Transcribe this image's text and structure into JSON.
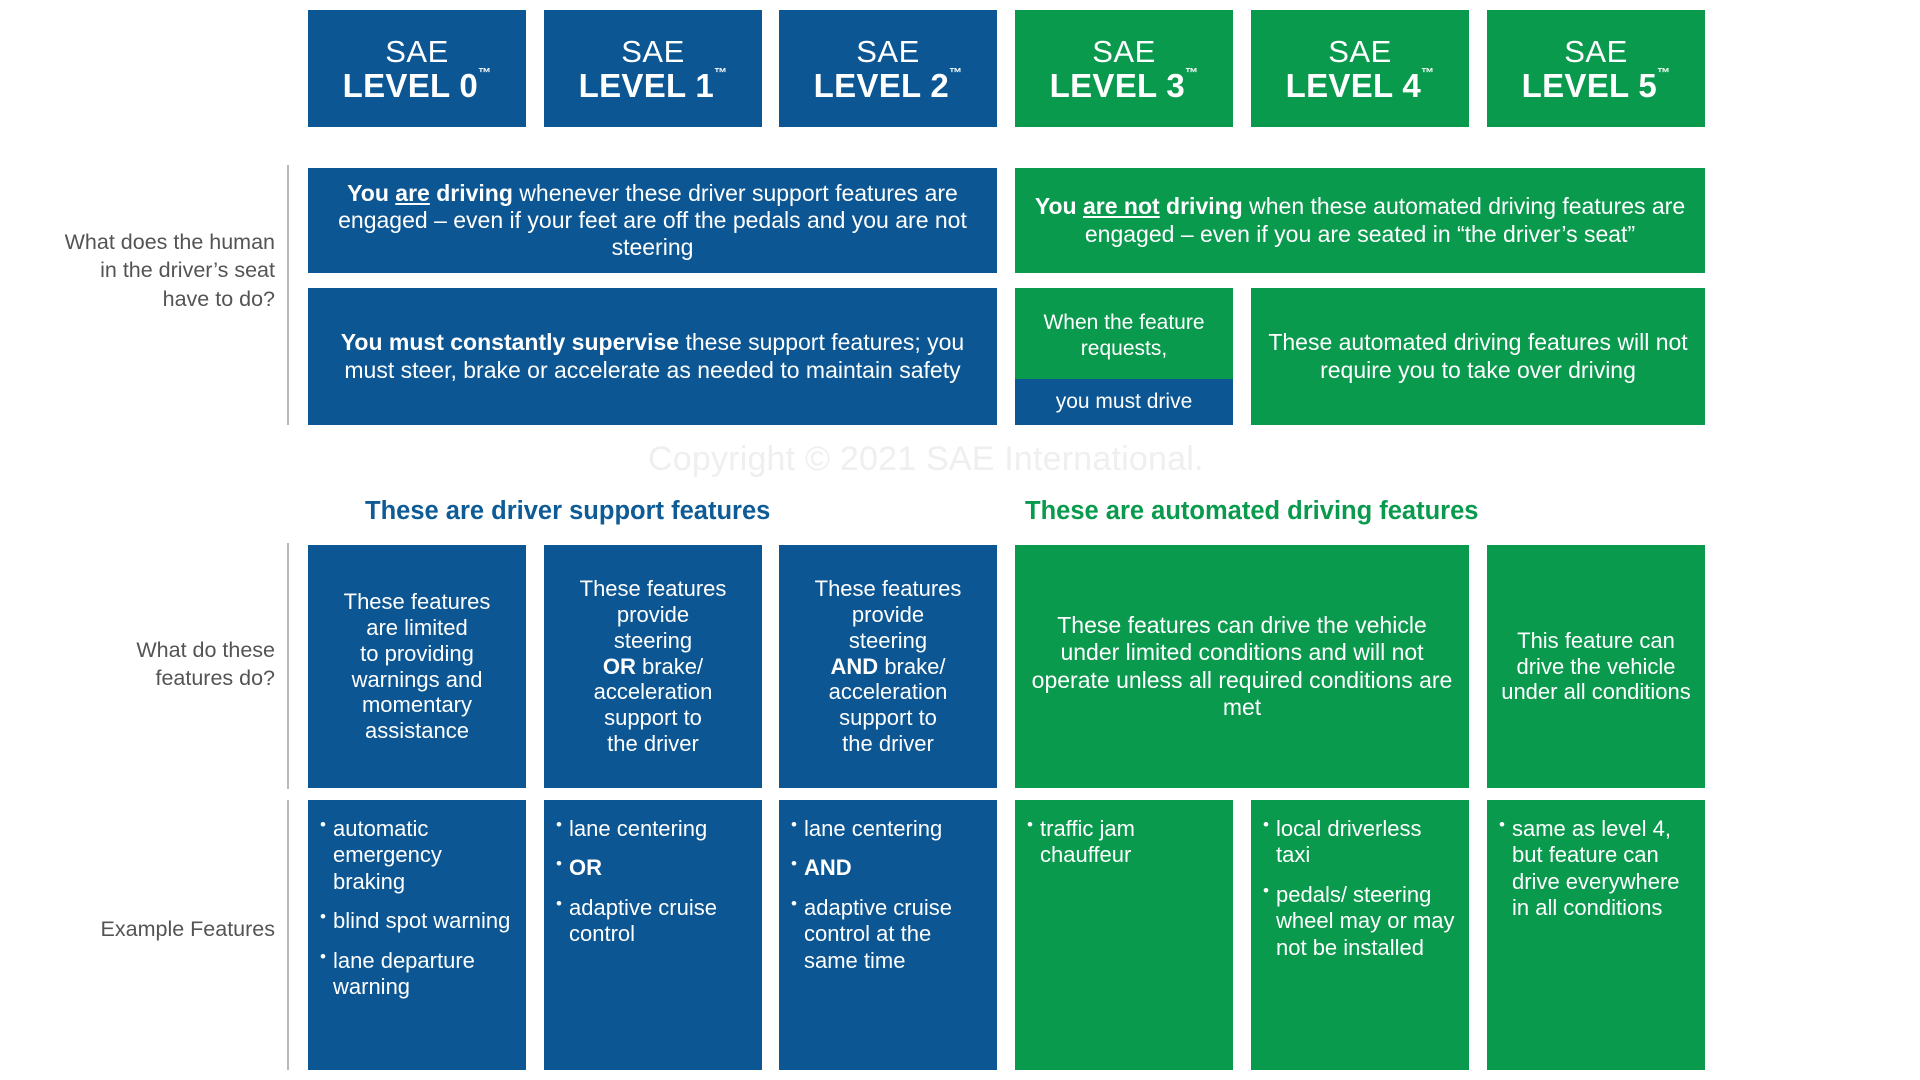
{
  "meta": {
    "watermark": "Copyright © 2021 SAE International.",
    "colors": {
      "blue": "#0b5693",
      "green": "#0a9a4e",
      "label_gray": "#545454",
      "watermark_gray": "#efefef"
    }
  },
  "levels": [
    {
      "id": "level-0",
      "sae": "SAE",
      "name": "LEVEL 0",
      "tm": "™",
      "color": "blue"
    },
    {
      "id": "level-1",
      "sae": "SAE",
      "name": "LEVEL 1",
      "tm": "™",
      "color": "blue"
    },
    {
      "id": "level-2",
      "sae": "SAE",
      "name": "LEVEL 2",
      "tm": "™",
      "color": "blue"
    },
    {
      "id": "level-3",
      "sae": "SAE",
      "name": "LEVEL 3",
      "tm": "™",
      "color": "green"
    },
    {
      "id": "level-4",
      "sae": "SAE",
      "name": "LEVEL 4",
      "tm": "™",
      "color": "green"
    },
    {
      "id": "level-5",
      "sae": "SAE",
      "name": "LEVEL 5",
      "tm": "™",
      "color": "green"
    }
  ],
  "rows": {
    "human_role": {
      "label": "What does the human in the driver’s seat have to do?",
      "driver_support": {
        "line1_bold": "You ",
        "line1_underline": "are",
        "line1_bold2": " driving",
        "rest": " whenever these driver support features are engaged – even if your feet are off the pedals and you are not steering",
        "full": "You are driving whenever these driver support features are engaged – even if your feet are off the pedals and you are not steering"
      },
      "automated_driving": {
        "line1_bold": "You ",
        "line1_underline": "are not",
        "line1_bold2": " driving",
        "rest": " when these automated driving features are engaged – even if you are seated in “the driver’s seat”",
        "full": "You are not driving when these automated driving features are engaged – even if you are seated in “the driver’s seat”"
      },
      "supervise": {
        "bold": "You must constantly supervise",
        "rest": " these support features; you must steer, brake or accelerate as needed to maintain safety"
      },
      "level3_request": {
        "top": "When the feature requests,",
        "bottom": "you must drive"
      },
      "level45_no_takeover": "These automated driving features will not require you to take over driving"
    },
    "features_do": {
      "label": "What do these features do?",
      "level0": {
        "l1": "These features",
        "l2": "are limited",
        "l3": "to providing",
        "l4": "warnings and",
        "l5": "momentary",
        "l6": "assistance"
      },
      "level1": {
        "l1": "These features",
        "l2": "provide",
        "l3": "steering",
        "l4_bold": "OR",
        "l4_rest": " brake/",
        "l5": "acceleration",
        "l6": "support to",
        "l7": "the driver"
      },
      "level2": {
        "l1": "These features",
        "l2": "provide",
        "l3": "steering",
        "l4_bold": "AND",
        "l4_rest": " brake/",
        "l5": "acceleration",
        "l6": "support to",
        "l7": "the driver"
      },
      "level34": "These features can drive the vehicle under limited conditions and will not operate unless all required conditions are met",
      "level5": "This feature can drive the vehicle under all conditions"
    },
    "examples": {
      "label": "Example Features",
      "level0": [
        "automatic emergency braking",
        "blind spot warning",
        "lane departure warning"
      ],
      "level1": [
        "lane centering",
        "OR",
        "adaptive cruise control"
      ],
      "level1_bold_index": 1,
      "level2": [
        "lane centering",
        "AND",
        "adaptive cruise control at the same time"
      ],
      "level2_bold_index": 1,
      "level3": [
        "traffic jam chauffeur"
      ],
      "level4": [
        "local driverless taxi",
        "pedals/ steering wheel may or may not be installed"
      ],
      "level5": [
        "same as level 4, but feature can drive everywhere in all conditions"
      ]
    }
  },
  "section_titles": {
    "driver_support": "These are driver support features",
    "automated_driving": "These are automated driving features"
  }
}
